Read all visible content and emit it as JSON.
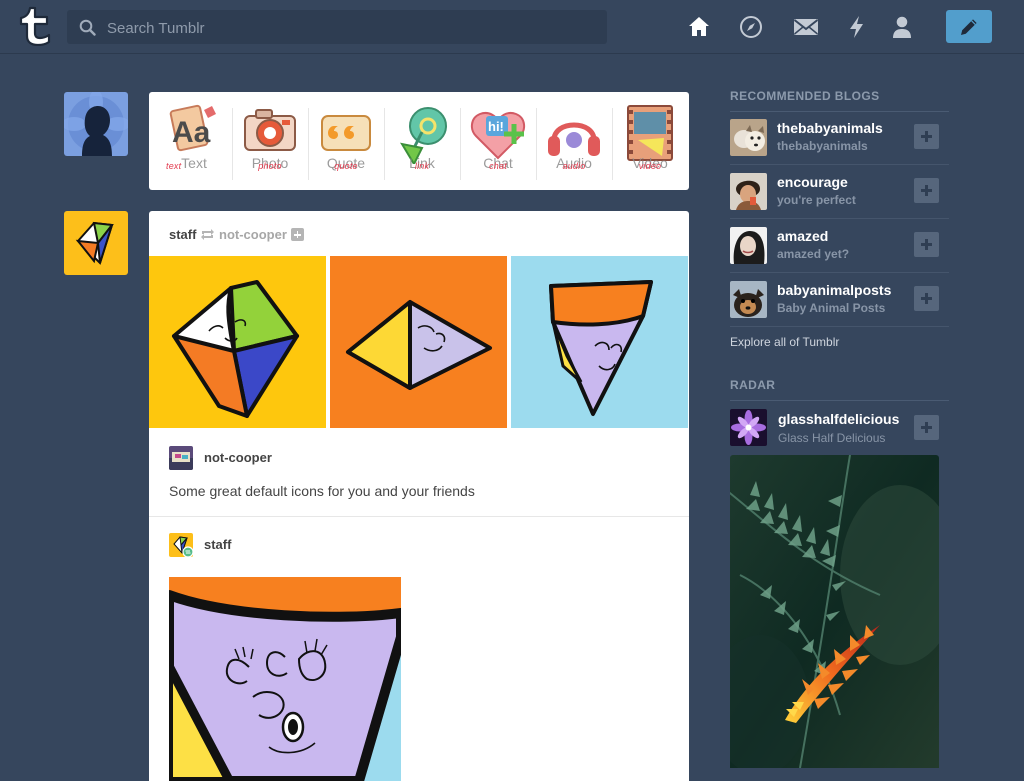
{
  "search": {
    "placeholder": "Search Tumblr"
  },
  "nav": {
    "items": [
      {
        "name": "home",
        "icon": "home-icon"
      },
      {
        "name": "explore",
        "icon": "compass-icon"
      },
      {
        "name": "inbox",
        "icon": "envelope-icon"
      },
      {
        "name": "activity",
        "icon": "lightning-icon"
      },
      {
        "name": "account",
        "icon": "person-icon"
      }
    ],
    "compose_icon": "pencil-icon"
  },
  "post_types": [
    {
      "label": "Text",
      "script": "text",
      "icon": "text-aa-icon"
    },
    {
      "label": "Photo",
      "script": "photo",
      "icon": "camera-icon"
    },
    {
      "label": "Quote",
      "script": "quote",
      "icon": "quote-icon"
    },
    {
      "label": "Link",
      "script": "link",
      "icon": "link-icon"
    },
    {
      "label": "Chat",
      "script": "chat",
      "icon": "chat-bubble-icon"
    },
    {
      "label": "Audio",
      "script": "audio",
      "icon": "headphones-icon"
    },
    {
      "label": "Video",
      "script": "video",
      "icon": "film-icon"
    }
  ],
  "post": {
    "author": "staff",
    "reblogged_from": "not-cooper",
    "trail": [
      {
        "name": "not-cooper",
        "text": "Some great default icons for you and your friends"
      },
      {
        "name": "staff",
        "text": ""
      }
    ]
  },
  "sidebar": {
    "recommended_title": "RECOMMENDED BLOGS",
    "recommended": [
      {
        "name": "thebabyanimals",
        "subtitle": "thebabyanimals"
      },
      {
        "name": "encourage",
        "subtitle": "you're perfect"
      },
      {
        "name": "amazed",
        "subtitle": "amazed yet?"
      },
      {
        "name": "babyanimalposts",
        "subtitle": "Baby Animal Posts"
      }
    ],
    "explore_link": "Explore all of Tumblr",
    "radar_title": "RADAR",
    "radar": {
      "name": "glasshalfdelicious",
      "subtitle": "Glass Half Delicious"
    }
  },
  "colors": {
    "background": "#36465d",
    "accent": "#529ecc",
    "search_bg": "#2e3d52"
  }
}
